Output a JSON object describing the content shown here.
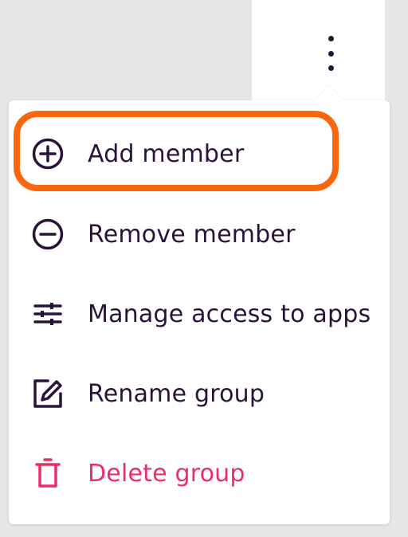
{
  "kebab": {
    "icon": "more-vertical-icon"
  },
  "menu": {
    "items": [
      {
        "label": "Add member",
        "icon": "plus-circle-icon",
        "tone": "default"
      },
      {
        "label": "Remove member",
        "icon": "minus-circle-icon",
        "tone": "default"
      },
      {
        "label": "Manage access to apps",
        "icon": "sliders-icon",
        "tone": "default"
      },
      {
        "label": "Rename group",
        "icon": "edit-square-icon",
        "tone": "default"
      },
      {
        "label": "Delete group",
        "icon": "trash-icon",
        "tone": "danger"
      }
    ]
  },
  "highlight": {
    "target": "Add member",
    "color": "#f8670e"
  },
  "colors": {
    "text": "#2a123b",
    "danger": "#ee2c66",
    "background": "#e6e6e6",
    "menu_surface": "#ffffff"
  }
}
